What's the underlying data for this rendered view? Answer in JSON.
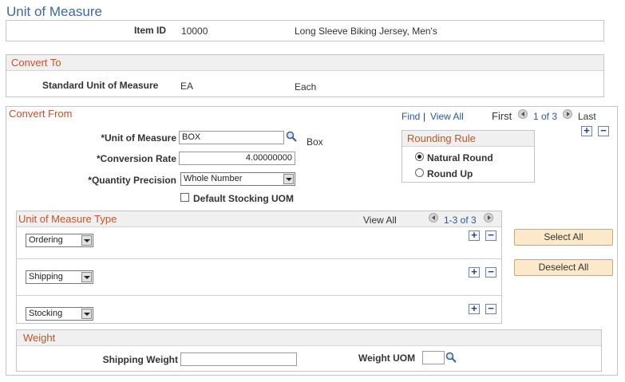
{
  "page_title": "Unit of Measure",
  "item": {
    "id_label": "Item ID",
    "id_value": "10000",
    "description": "Long Sleeve Biking Jersey, Men's"
  },
  "convert_to": {
    "header": "Convert To",
    "std_uom_label": "Standard Unit of Measure",
    "std_uom_value": "EA",
    "std_uom_desc": "Each"
  },
  "convert_from": {
    "header": "Convert From",
    "nav": {
      "find": "Find",
      "separator": "|",
      "view_all": "View All",
      "first": "First",
      "position": "1 of 3",
      "last": "Last"
    },
    "uom_label": "*Unit of Measure",
    "uom_value": "BOX",
    "uom_desc": "Box",
    "rate_label": "*Conversion Rate",
    "rate_value": "4.00000000",
    "precision_label": "*Quantity Precision",
    "precision_value": "Whole Number",
    "default_stocking_label": "Default Stocking UOM",
    "default_stocking_checked": false
  },
  "rounding_rule": {
    "header": "Rounding Rule",
    "options": [
      {
        "label": "Natural Round",
        "selected": true
      },
      {
        "label": "Round Up",
        "selected": false
      }
    ]
  },
  "uom_type": {
    "header": "Unit of Measure Type",
    "view_all": "View All",
    "position": "1-3 of 3",
    "rows": [
      {
        "value": "Ordering"
      },
      {
        "value": "Shipping"
      },
      {
        "value": "Stocking"
      }
    ],
    "select_all": "Select All",
    "deselect_all": "Deselect All"
  },
  "weight": {
    "header": "Weight",
    "shipping_weight_label": "Shipping Weight",
    "shipping_weight_value": "",
    "weight_uom_label": "Weight UOM",
    "weight_uom_value": ""
  },
  "icons": {
    "lookup": "magnifier-icon",
    "add": "plus-icon",
    "remove": "minus-icon",
    "prev": "previous-arrow-icon",
    "next": "next-arrow-icon"
  },
  "colors": {
    "section_header_text": "#c4532a",
    "title_text": "#3c6aa3",
    "link": "#2a5a9a",
    "button_bg": "#fbe9c9"
  }
}
